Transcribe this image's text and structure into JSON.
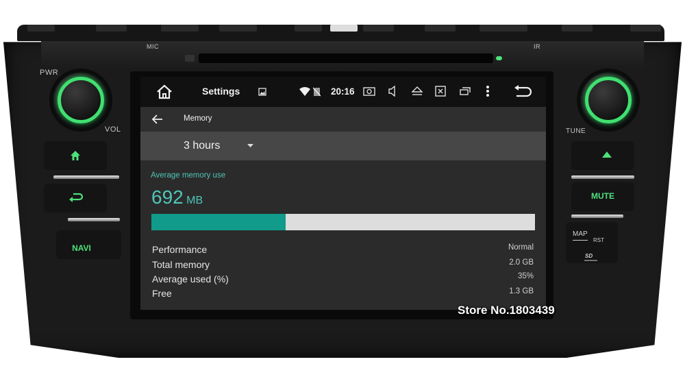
{
  "device": {
    "labels": {
      "pwr": "PWR",
      "mic": "MIC",
      "ir": "IR",
      "vol": "VOL",
      "tune": "TUNE",
      "mute": "MUTE",
      "navi": "NAVI",
      "map": "MAP",
      "rst": "RST"
    },
    "accent_color": "#4ee07c"
  },
  "statusbar": {
    "title": "Settings",
    "time": "20:16",
    "icons": [
      "home-icon",
      "image-icon",
      "wifi-icon",
      "no-sim-icon",
      "screenshot-icon",
      "volume-icon",
      "eject-icon",
      "close-window-icon",
      "recent-apps-icon",
      "overflow-menu-icon",
      "back-icon"
    ]
  },
  "appbar": {
    "title": "Memory"
  },
  "spinner": {
    "selected": "3 hours"
  },
  "memory": {
    "section_title": "Average memory use",
    "value": "692",
    "unit": "MB",
    "usage_fraction": 0.35,
    "accent_color": "#119b8a",
    "rows": [
      {
        "label": "Performance",
        "value": "Normal"
      },
      {
        "label": "Total memory",
        "value": "2.0 GB"
      },
      {
        "label": "Average used (%)",
        "value": "35%"
      },
      {
        "label": "Free",
        "value": "1.3 GB"
      }
    ]
  },
  "watermark": "Store No.1803439"
}
